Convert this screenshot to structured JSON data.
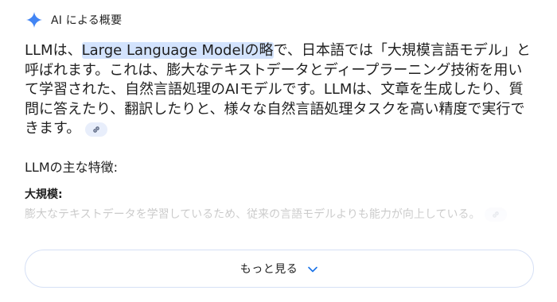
{
  "header": {
    "label": "AI による概要",
    "icon": "sparkle-icon",
    "icon_color": "#4285f4"
  },
  "answer": {
    "before_highlight": "LLMは、",
    "highlight": "Large Language Modelの略",
    "after_highlight": "で、日本語では「大規模言語モデル」と呼ばれます。これは、膨大なテキストデータとディープラーニング技術を用いて学習された、自然言語処理のAIモデルです。LLMは、文章を生成したり、質問に答えたり、翻訳したりと、様々な自然言語処理タスクを高い精度で実行できます。",
    "highlight_color": "#d3e3fd",
    "link_icon": "link-icon"
  },
  "features": {
    "heading": "LLMの主な特徴:",
    "items": [
      {
        "title": "大規模:",
        "description": "膨大なテキストデータを学習しているため、従来の言語モデルよりも能力が向上している。"
      }
    ]
  },
  "show_more": {
    "label": "もっと見る",
    "icon": "chevron-down-icon",
    "accent": "#1a73e8"
  }
}
